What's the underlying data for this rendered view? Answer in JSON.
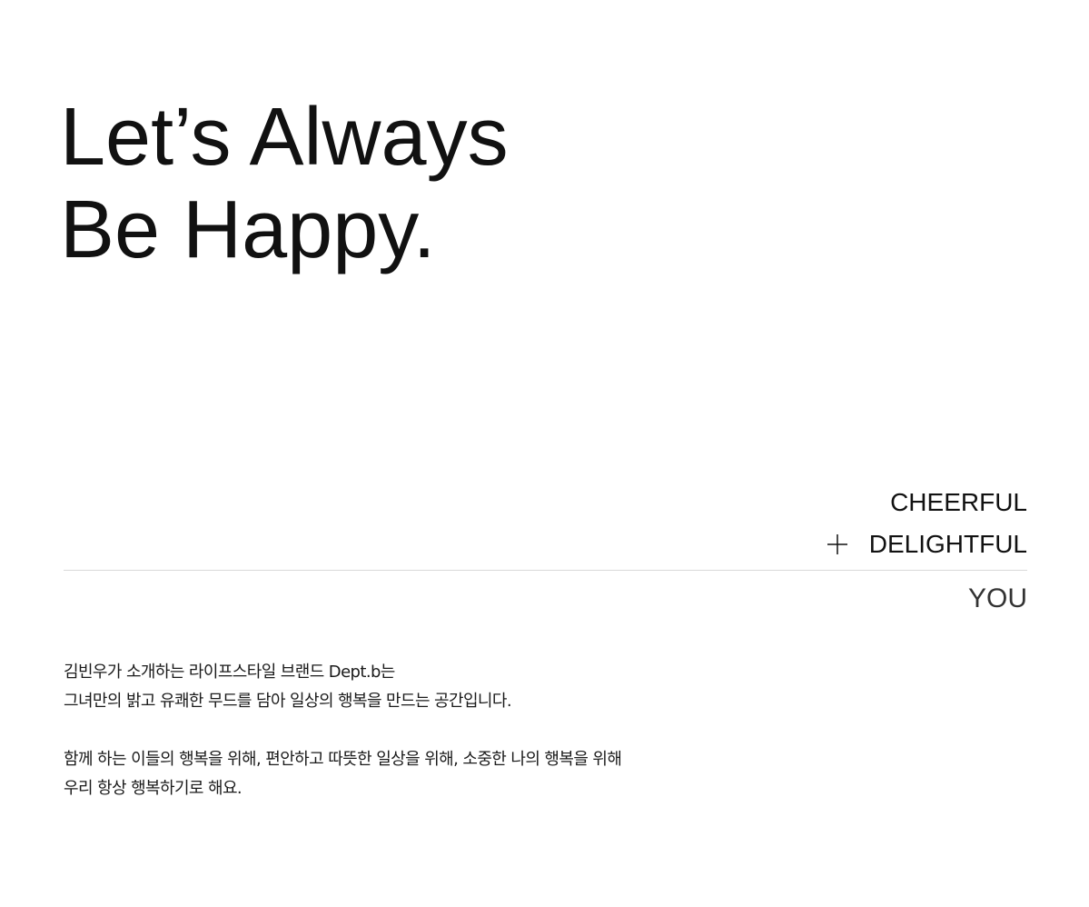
{
  "hero": {
    "line1": "Let’s Always",
    "line2": "Be Happy."
  },
  "words": {
    "cheerful": "CHEERFUL",
    "delightful": "DELIGHTFUL",
    "you": "YOU",
    "plus_icon": "plus-icon"
  },
  "description": {
    "paragraph1": {
      "line1": "김빈우가 소개하는 라이프스타일 브랜드 Dept.b는",
      "line2": "그녀만의 밝고 유쾌한 무드를 담아 일상의 행복을 만드는 공간입니다."
    },
    "paragraph2": {
      "line1": "함께 하는 이들의 행복을 위해, 편안하고 따뜻한 일상을 위해, 소중한 나의 행복을 위해",
      "line2": "우리 항상 행복하기로 해요."
    }
  },
  "colors": {
    "text": "#111111",
    "divider": "#d9d9d9",
    "background": "#ffffff"
  }
}
